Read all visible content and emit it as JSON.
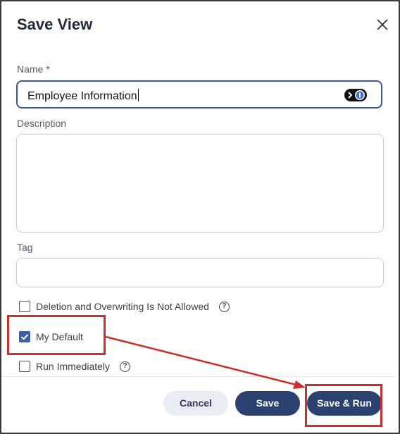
{
  "dialog": {
    "title": "Save View",
    "close_icon": "close-icon"
  },
  "form": {
    "name": {
      "label": "Name",
      "required_mark": "*",
      "value": "Employee Information",
      "password_manager_icon": "password-manager-icon"
    },
    "description": {
      "label": "Description",
      "value": ""
    },
    "tag": {
      "label": "Tag",
      "value": ""
    },
    "options": [
      {
        "label": "Deletion and Overwriting Is Not Allowed",
        "checked": false,
        "help_icon": "help-circle-icon"
      },
      {
        "label": "My Default",
        "checked": true
      },
      {
        "label": "Run Immediately",
        "checked": false,
        "help_icon": "help-circle-icon"
      }
    ],
    "help_glyph": "?"
  },
  "footer": {
    "cancel_label": "Cancel",
    "save_label": "Save",
    "save_run_label": "Save & Run"
  },
  "colors": {
    "primary": "#2b4170",
    "focus_border": "#3b5799",
    "checkbox_checked": "#3b5fa6",
    "annotation": "#c9302c",
    "required": "#d62828"
  }
}
